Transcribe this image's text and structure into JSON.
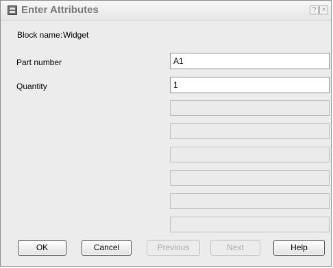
{
  "window": {
    "title": "Enter Attributes",
    "help_glyph": "?",
    "close_glyph": "×"
  },
  "block": {
    "label": "Block name:",
    "value": "Widget"
  },
  "attributes": [
    {
      "label": "Part number",
      "value": "A1"
    },
    {
      "label": "Quantity",
      "value": "1"
    }
  ],
  "buttons": {
    "ok": "OK",
    "cancel": "Cancel",
    "previous": "Previous",
    "next": "Next",
    "help": "Help"
  }
}
